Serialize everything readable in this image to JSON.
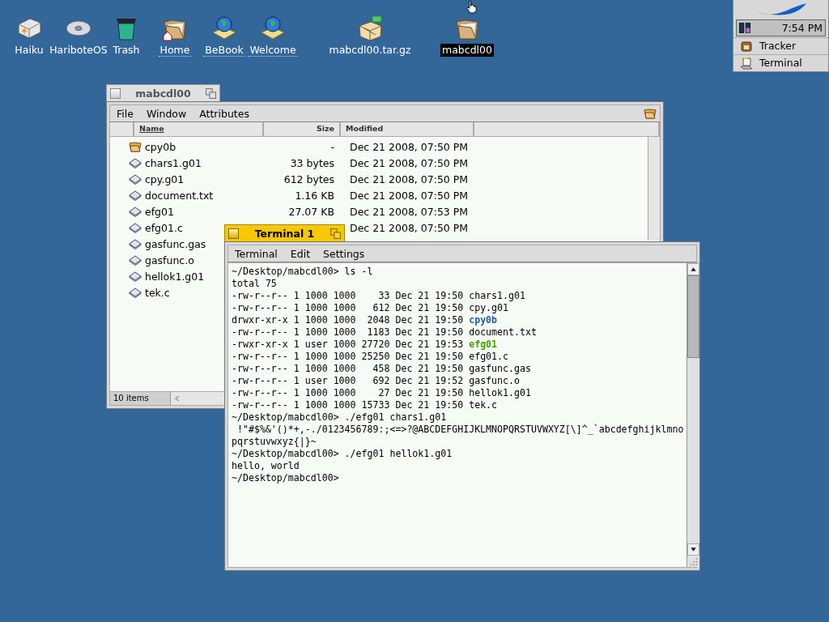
{
  "desktop_icons": [
    {
      "label": "Haiku",
      "kind": "volume",
      "link": false,
      "selected": false
    },
    {
      "label": "HariboteOS",
      "kind": "disk",
      "link": false,
      "selected": false
    },
    {
      "label": "Trash",
      "kind": "trash",
      "link": false,
      "selected": false
    },
    {
      "label": "Home",
      "kind": "home",
      "link": true,
      "selected": false
    },
    {
      "label": "BeBook",
      "kind": "globe",
      "link": true,
      "selected": false
    },
    {
      "label": "Welcome",
      "kind": "globe",
      "link": true,
      "selected": false
    },
    {
      "label": "mabcdl00.tar.gz",
      "kind": "archive",
      "link": false,
      "selected": false
    },
    {
      "label": "mabcdl00",
      "kind": "folder",
      "link": false,
      "selected": true
    }
  ],
  "deskbar": {
    "time": "7:54 PM",
    "items": [
      {
        "label": "Tracker",
        "kind": "tracker"
      },
      {
        "label": "Terminal",
        "kind": "terminal"
      }
    ]
  },
  "tracker_window": {
    "title": "mabcdl00",
    "active": false,
    "menu": [
      "File",
      "Window",
      "Attributes"
    ],
    "columns": [
      {
        "label": "Name",
        "sorted": true
      },
      {
        "label": "Size",
        "sorted": false
      },
      {
        "label": "Modified",
        "sorted": false
      }
    ],
    "rows": [
      {
        "name": "cpy0b",
        "kind": "folder",
        "size": "-",
        "modified": "Dec 21 2008, 07:50 PM"
      },
      {
        "name": "chars1.g01",
        "kind": "file",
        "size": "33 bytes",
        "modified": "Dec 21 2008, 07:50 PM"
      },
      {
        "name": "cpy.g01",
        "kind": "file",
        "size": "612 bytes",
        "modified": "Dec 21 2008, 07:50 PM"
      },
      {
        "name": "document.txt",
        "kind": "file",
        "size": "1.16 KB",
        "modified": "Dec 21 2008, 07:50 PM"
      },
      {
        "name": "efg01",
        "kind": "file",
        "size": "27.07 KB",
        "modified": "Dec 21 2008, 07:53 PM"
      },
      {
        "name": "efg01.c",
        "kind": "file",
        "modified": "Dec 21 2008, 07:50 PM"
      },
      {
        "name": "gasfunc.gas",
        "kind": "file"
      },
      {
        "name": "gasfunc.o",
        "kind": "file"
      },
      {
        "name": "hellok1.g01",
        "kind": "file"
      },
      {
        "name": "tek.c",
        "kind": "file"
      }
    ],
    "status": "10 items"
  },
  "terminal_window": {
    "title": "Terminal 1",
    "active": true,
    "menu": [
      "Terminal",
      "Edit",
      "Settings"
    ],
    "lines": [
      {
        "text": "~/Desktop/mabcdl00> ls -l"
      },
      {
        "text": "total 75"
      },
      {
        "text": "-rw-r--r-- 1 1000 1000    33 Dec 21 19:50 ",
        "file": "chars1.g01"
      },
      {
        "text": "-rw-r--r-- 1 1000 1000   612 Dec 21 19:50 ",
        "file": "cpy.g01"
      },
      {
        "text": "drwxr-xr-x 1 1000 1000  2048 Dec 21 19:50 ",
        "file": "cpy0b",
        "color": "#2060a8"
      },
      {
        "text": "-rw-r--r-- 1 1000 1000  1183 Dec 21 19:50 ",
        "file": "document.txt"
      },
      {
        "text": "-rwxr-xr-x 1 user 1000 27720 Dec 21 19:53 ",
        "file": "efg01",
        "color": "#40a000"
      },
      {
        "text": "-rw-r--r-- 1 1000 1000 25250 Dec 21 19:50 ",
        "file": "efg01.c"
      },
      {
        "text": "-rw-r--r-- 1 1000 1000   458 Dec 21 19:50 ",
        "file": "gasfunc.gas"
      },
      {
        "text": "-rw-r--r-- 1 user 1000   692 Dec 21 19:52 ",
        "file": "gasfunc.o"
      },
      {
        "text": "-rw-r--r-- 1 1000 1000    27 Dec 21 19:50 ",
        "file": "hellok1.g01"
      },
      {
        "text": "-rw-r--r-- 1 1000 1000 15733 Dec 21 19:50 ",
        "file": "tek.c"
      },
      {
        "text": "~/Desktop/mabcdl00> ./efg01 chars1.g01"
      },
      {
        "text": " !\"#$%&'()*+,-./0123456789:;<=>?@ABCDEFGHIJKLMNOPQRSTUVWXYZ[\\]^_`abcdefghijklmno"
      },
      {
        "text": "pqrstuvwxyz{|}~"
      },
      {
        "text": "~/Desktop/mabcdl00> ./efg01 hellok1.g01"
      },
      {
        "text": "hello, world"
      },
      {
        "text": "~/Desktop/mabcdl00>"
      }
    ]
  }
}
